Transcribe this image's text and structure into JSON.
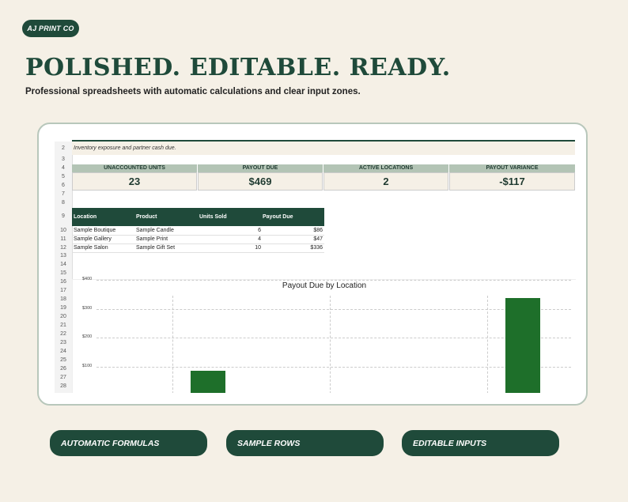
{
  "brand": "AJ PRINT CO",
  "hero": {
    "title": "POLISHED. EDITABLE. READY.",
    "subtitle": "Professional spreadsheets with automatic calculations and clear input zones."
  },
  "sheet": {
    "rows": [
      "2",
      "3",
      "4",
      "5",
      "6",
      "7",
      "8",
      "9",
      "10",
      "11",
      "12",
      "13",
      "14",
      "15",
      "16",
      "17",
      "18",
      "19",
      "20",
      "21",
      "22",
      "23",
      "24",
      "25",
      "26",
      "27",
      "28"
    ],
    "note": "Inventory exposure and partner cash due.",
    "kpis": [
      {
        "label": "UNACCOUNTED UNITS",
        "value": "23"
      },
      {
        "label": "PAYOUT DUE",
        "value": "$469"
      },
      {
        "label": "ACTIVE LOCATIONS",
        "value": "2"
      },
      {
        "label": "PAYOUT VARIANCE",
        "value": "-$117"
      }
    ],
    "table": {
      "headers": [
        "Location",
        "Product",
        "Units Sold",
        "Payout Due"
      ],
      "rows": [
        [
          "Sample Boutique",
          "Sample Candle",
          "6",
          "$86"
        ],
        [
          "Sample Gallery",
          "Sample Print",
          "4",
          "$47"
        ],
        [
          "Sample Salon",
          "Sample Gift Set",
          "10",
          "$336"
        ]
      ]
    }
  },
  "chart_data": {
    "type": "bar",
    "title": "Payout Due by Location",
    "y_ticks": [
      "$400",
      "$300",
      "$200",
      "$100"
    ],
    "values": [
      86,
      336
    ],
    "ylim": [
      0,
      400
    ],
    "color": "#1e6f2a",
    "grid": true
  },
  "features": [
    "AUTOMATIC FORMULAS",
    "SAMPLE ROWS",
    "EDITABLE INPUTS"
  ]
}
